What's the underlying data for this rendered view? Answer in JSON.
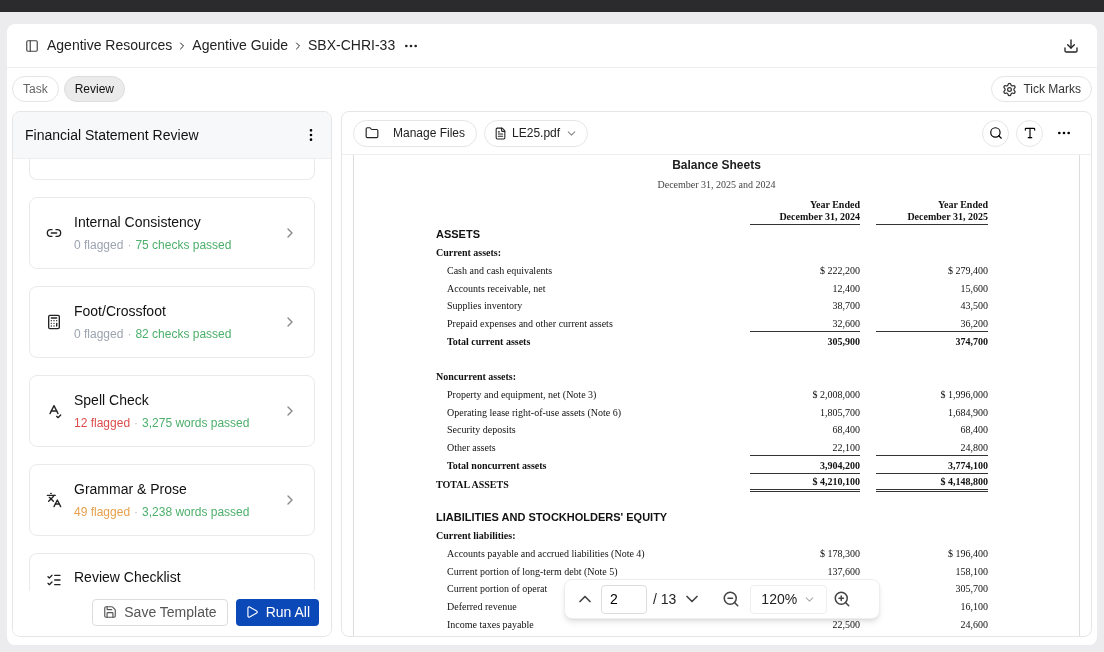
{
  "breadcrumb": [
    "Agentive Resources",
    "Agentive Guide",
    "SBX-CHRI-33"
  ],
  "tabs": [
    {
      "label": "Task",
      "selected": false
    },
    {
      "label": "Review",
      "selected": true
    }
  ],
  "tick_marks": "Tick Marks",
  "panel": {
    "title": "Financial Statement Review",
    "checks": [
      {
        "kind": "link",
        "name": "Internal Consistency",
        "flagged": "0 flagged",
        "color": "#9ca3af",
        "separator": "·",
        "passed": "75 checks passed"
      },
      {
        "kind": "calculator",
        "name": "Foot/Crossfoot",
        "flagged": "0 flagged",
        "color": "#9ca3af",
        "separator": "·",
        "passed": "82 checks passed"
      },
      {
        "kind": "spell",
        "name": "Spell Check",
        "flagged": "12 flagged",
        "color": "#dc4c4c",
        "separator": "·",
        "passed": "3,275 words passed"
      },
      {
        "kind": "language",
        "name": "Grammar & Prose",
        "flagged": "49 flagged",
        "color": "#e8a04c",
        "separator": "·",
        "passed": "3,238 words passed"
      },
      {
        "kind": "checklist",
        "name": "Review Checklist"
      }
    ],
    "save": "Save Template",
    "run": "Run All"
  },
  "viewer": {
    "manage": "Manage Files",
    "file": "LE25.pdf",
    "page": "2",
    "pages": "/ 13",
    "zoom": "120%"
  },
  "document": {
    "title": "Balance Sheets",
    "subtitle": "December 31, 2025 and 2024",
    "columns": [
      {
        "line1": "Year Ended",
        "line2": "December 31, 2024"
      },
      {
        "line1": "Year Ended",
        "line2": "December 31, 2025"
      }
    ],
    "rows": [
      {
        "kind": "heading",
        "label": "ASSETS"
      },
      {
        "kind": "subheading",
        "label": "Current assets:"
      },
      {
        "kind": "item",
        "label": "Cash and cash equivalents",
        "values": [
          "$ 222,200",
          "$ 279,400"
        ]
      },
      {
        "kind": "item",
        "label": "Accounts receivable, net",
        "values": [
          "12,400",
          "15,600"
        ]
      },
      {
        "kind": "item",
        "label": "Supplies inventory",
        "values": [
          "38,700",
          "43,500"
        ]
      },
      {
        "kind": "item",
        "label": "Prepaid expenses and other current assets",
        "values": [
          "32,600",
          "36,200"
        ]
      },
      {
        "kind": "total",
        "label": "Total current assets",
        "values": [
          "305,900",
          "374,700"
        ]
      },
      {
        "kind": "spacer"
      },
      {
        "kind": "subheading",
        "label": "Noncurrent assets:"
      },
      {
        "kind": "item",
        "label": "Property and equipment, net (Note 3)",
        "values": [
          "$ 2,008,000",
          "$ 1,996,000"
        ]
      },
      {
        "kind": "item",
        "label": "Operating lease right-of-use assets (Note 6)",
        "values": [
          "1,805,700",
          "1,684,900"
        ]
      },
      {
        "kind": "item",
        "label": "Security deposits",
        "values": [
          "68,400",
          "68,400"
        ]
      },
      {
        "kind": "item",
        "label": "Other assets",
        "values": [
          "22,100",
          "24,800"
        ]
      },
      {
        "kind": "total",
        "label": "Total noncurrent assets",
        "values": [
          "3,904,200",
          "3,774,100"
        ]
      },
      {
        "kind": "grand",
        "label": "TOTAL ASSETS",
        "values": [
          "$ 4,210,100",
          "$ 4,148,800"
        ]
      },
      {
        "kind": "spacer"
      },
      {
        "kind": "heading",
        "label": "LIABILITIES AND STOCKHOLDERS' EQUITY"
      },
      {
        "kind": "subheading",
        "label": "Current liabilities:"
      },
      {
        "kind": "item",
        "label": "Accounts payable and accrued liabilities (Note 4)",
        "values": [
          "$ 178,300",
          "$ 196,400"
        ]
      },
      {
        "kind": "item",
        "label": "Current portion of long-term debt (Note 5)",
        "values": [
          "137,600",
          "158,100"
        ]
      },
      {
        "kind": "item",
        "label": "Current portion of operat",
        "value_2025": "305,700"
      },
      {
        "kind": "item",
        "label": "Deferred revenue",
        "value_2025": "16,100"
      },
      {
        "kind": "item",
        "label": "Income taxes payable",
        "values": [
          "22,500",
          "24,600"
        ]
      }
    ]
  }
}
